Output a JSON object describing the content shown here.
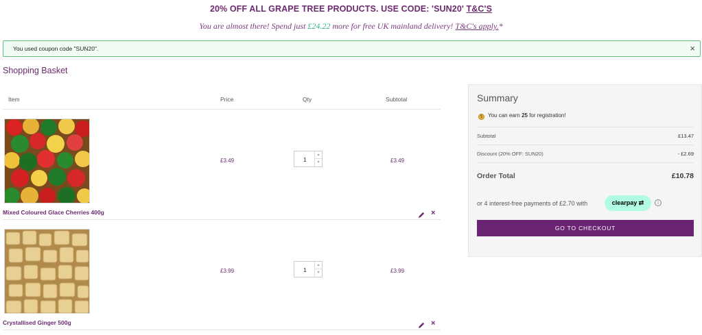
{
  "promo": {
    "text": "20% OFF ALL GRAPE TREE PRODUCTS. USE CODE: 'SUN20' ",
    "link": "T&C'S"
  },
  "delivery": {
    "prefix": "You are almost there! Spend just ",
    "amount": "£24.22",
    "suffix": " more for free UK mainland delivery! ",
    "link": "T&C's apply.",
    "asterisk": "*"
  },
  "coupon": {
    "message": "You used coupon code \"SUN20\".",
    "close": "×"
  },
  "page_title": "Shopping Basket",
  "table": {
    "col_item": "Item",
    "col_price": "Price",
    "col_qty": "Qty",
    "col_subtotal": "Subtotal"
  },
  "items": [
    {
      "name": "Mixed Coloured Glace Cherries 400g",
      "price": "£3.49",
      "qty": "1",
      "subtotal": "£3.49",
      "remove": "×"
    },
    {
      "name": "Crystallised Ginger 500g",
      "price": "£3.99",
      "qty": "1",
      "subtotal": "£3.99",
      "remove": "×"
    }
  ],
  "summary": {
    "title": "Summary",
    "earn_prefix": "You can earn ",
    "earn_points": "25",
    "earn_suffix": " for registration!",
    "subtotal_label": "Subtotal",
    "subtotal_value": "£13.47",
    "discount_label": "Discount (20% OFF: SUN20)",
    "discount_value": "- £2.69",
    "total_label": "Order Total",
    "total_value": "£10.78",
    "clearpay_text": "or 4 interest-free payments of £2.70 with",
    "clearpay_brand": "clearpay",
    "info": "i",
    "checkout_label": "GO TO CHECKOUT"
  },
  "colors": {
    "brand": "#6b2474",
    "coupon_border": "#5cc27a",
    "clearpay": "#b2fce4",
    "amount": "#2bb08a"
  }
}
